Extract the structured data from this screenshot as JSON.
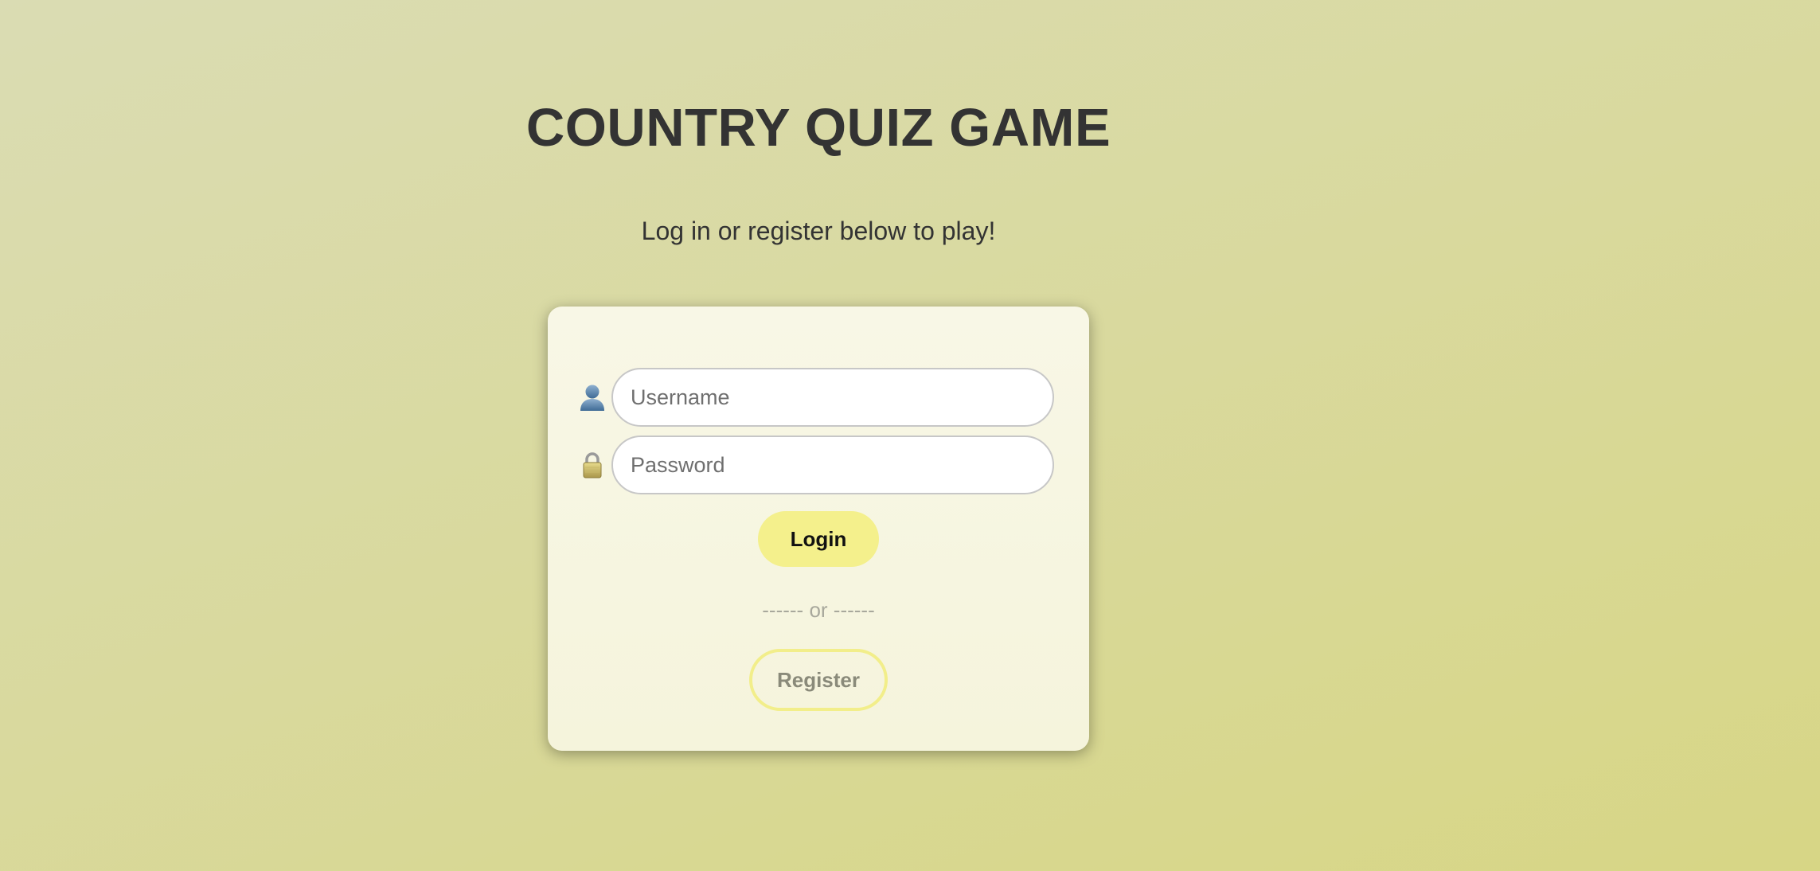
{
  "page": {
    "title": "COUNTRY QUIZ GAME",
    "subtitle": "Log in or register below to play!"
  },
  "login_form": {
    "username": {
      "placeholder": "Username",
      "value": "",
      "icon": "user-icon"
    },
    "password": {
      "placeholder": "Password",
      "value": "",
      "icon": "lock-icon"
    },
    "login_label": "Login",
    "divider_text": "------ or ------",
    "register_label": "Register"
  },
  "colors": {
    "background": "#d9d99d",
    "card": "#f7f6e2",
    "login_button": "#f4f08c",
    "register_border": "#f2ee8a",
    "title_text": "#333333"
  }
}
